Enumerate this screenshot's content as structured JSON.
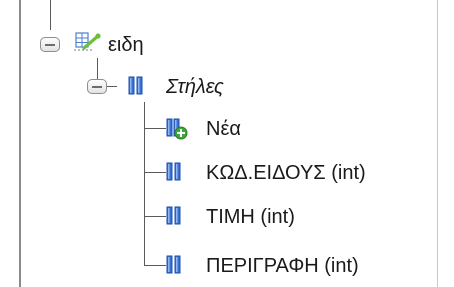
{
  "tree": {
    "table_node": {
      "label": "ειδη",
      "icon": "table-link-icon"
    },
    "columns_node": {
      "label": "Στήλες",
      "icon": "columns-icon"
    },
    "column_items": [
      {
        "label": "Νέα",
        "icon": "new-column-icon"
      },
      {
        "label": "ΚΩΔ.ΕΙΔΟΥΣ (int)",
        "icon": "column-icon"
      },
      {
        "label": "ΤΙΜΗ (int)",
        "icon": "column-icon"
      },
      {
        "label": "ΠΕΡΙΓΡΑΦΗ (int)",
        "icon": "column-icon"
      }
    ]
  },
  "colors": {
    "column_blue": "#2f63c4",
    "column_blue_light": "#6fa0f0",
    "add_green": "#3fa63a",
    "link_green": "#6dbf3a",
    "tree_line": "#5a5a5a"
  }
}
